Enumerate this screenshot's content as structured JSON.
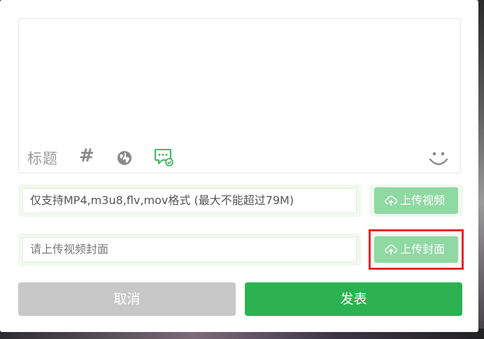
{
  "editor": {
    "title_label": "标题",
    "hash_symbol": "#",
    "icons": [
      "globe-icon",
      "chat-check-icon",
      "smile-icon"
    ]
  },
  "video": {
    "placeholder": "仅支持MP4,m3u8,flv,mov格式 (最大不能超过79M)",
    "upload_label": "上传视频"
  },
  "cover": {
    "placeholder": "请上传视频封面",
    "upload_label": "上传封面"
  },
  "actions": {
    "cancel_label": "取消",
    "publish_label": "发表"
  },
  "colors": {
    "primary_green": "#2cb250",
    "upload_green": "#8fd9a2",
    "row_bg": "#f1f9ee",
    "cancel_gray": "#c8c8c8",
    "highlight_red": "#e8242a"
  }
}
